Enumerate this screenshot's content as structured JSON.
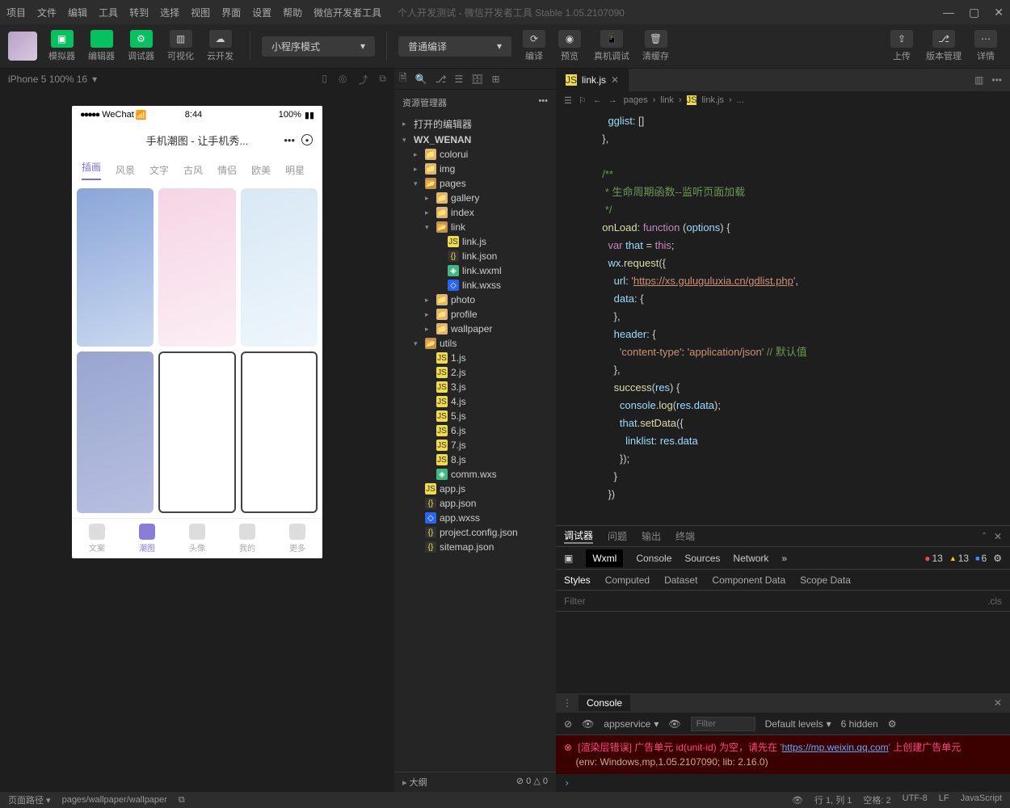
{
  "menubar": [
    "项目",
    "文件",
    "编辑",
    "工具",
    "转到",
    "选择",
    "视图",
    "界面",
    "设置",
    "帮助",
    "微信开发者工具"
  ],
  "window_title": "个人开发测试 - 微信开发者工具 Stable 1.05.2107090",
  "toolbar": {
    "groups_a": [
      {
        "label": "模拟器",
        "green": true
      },
      {
        "label": "编辑器",
        "green": true
      },
      {
        "label": "调试器",
        "green": true
      },
      {
        "label": "可视化",
        "green": false
      },
      {
        "label": "云开发",
        "green": false
      }
    ],
    "mode_dropdown": "小程序模式",
    "compile_dropdown": "普通编译",
    "mid": [
      "编译",
      "预览",
      "真机调试",
      "清缓存"
    ],
    "right": [
      "上传",
      "版本管理",
      "详情"
    ]
  },
  "sim": {
    "device": "iPhone 5 100% 16",
    "status_carrier": "WeChat",
    "status_time": "8:44",
    "status_batt": "100%",
    "app_title": "手机潮图 - 让手机秀...",
    "tabs": [
      "插画",
      "风景",
      "文字",
      "古风",
      "情侣",
      "欧美",
      "明星"
    ],
    "bottom": [
      "文案",
      "潮图",
      "头像",
      "我的",
      "更多"
    ]
  },
  "explorer": {
    "header": "资源管理器",
    "sections": [
      "打开的编辑器",
      "WX_WENAN"
    ],
    "tree": [
      {
        "l": 1,
        "t": "folder",
        "n": "colorui",
        "a": "▸"
      },
      {
        "l": 1,
        "t": "folder",
        "n": "img",
        "a": "▸"
      },
      {
        "l": 1,
        "t": "folder-open",
        "n": "pages",
        "a": "▾"
      },
      {
        "l": 2,
        "t": "folder",
        "n": "gallery",
        "a": "▸"
      },
      {
        "l": 2,
        "t": "folder",
        "n": "index",
        "a": "▸"
      },
      {
        "l": 2,
        "t": "folder-open",
        "n": "link",
        "a": "▾"
      },
      {
        "l": 3,
        "t": "js",
        "n": "link.js"
      },
      {
        "l": 3,
        "t": "json",
        "n": "link.json"
      },
      {
        "l": 3,
        "t": "wxml",
        "n": "link.wxml"
      },
      {
        "l": 3,
        "t": "wxss",
        "n": "link.wxss"
      },
      {
        "l": 2,
        "t": "folder",
        "n": "photo",
        "a": "▸"
      },
      {
        "l": 2,
        "t": "folder",
        "n": "profile",
        "a": "▸"
      },
      {
        "l": 2,
        "t": "folder",
        "n": "wallpaper",
        "a": "▸"
      },
      {
        "l": 1,
        "t": "folder-open",
        "n": "utils",
        "a": "▾"
      },
      {
        "l": 2,
        "t": "js",
        "n": "1.js"
      },
      {
        "l": 2,
        "t": "js",
        "n": "2.js"
      },
      {
        "l": 2,
        "t": "js",
        "n": "3.js"
      },
      {
        "l": 2,
        "t": "js",
        "n": "4.js"
      },
      {
        "l": 2,
        "t": "js",
        "n": "5.js"
      },
      {
        "l": 2,
        "t": "js",
        "n": "6.js"
      },
      {
        "l": 2,
        "t": "js",
        "n": "7.js"
      },
      {
        "l": 2,
        "t": "js",
        "n": "8.js"
      },
      {
        "l": 2,
        "t": "wxml",
        "n": "comm.wxs"
      },
      {
        "l": 1,
        "t": "js",
        "n": "app.js"
      },
      {
        "l": 1,
        "t": "json",
        "n": "app.json"
      },
      {
        "l": 1,
        "t": "wxss",
        "n": "app.wxss"
      },
      {
        "l": 1,
        "t": "json",
        "n": "project.config.json"
      },
      {
        "l": 1,
        "t": "json",
        "n": "sitemap.json"
      }
    ],
    "outline": "大纲",
    "outline_counts": "⊘ 0 △ 0"
  },
  "editor": {
    "tab": "link.js",
    "breadcrumb": [
      "pages",
      "link",
      "link.js",
      "..."
    ],
    "code_comment1": "/**",
    "code_comment2": " * 生命周期函数--监听页面加载",
    "code_comment3": " */",
    "url": "https://xs.guluguluxia.cn/gdlist.php",
    "header_ct": "content-type",
    "header_val": "application/json",
    "header_comm": "// 默认值"
  },
  "devtools": {
    "top_tabs": [
      "调试器",
      "问题",
      "输出",
      "终端"
    ],
    "panels": [
      "Wxml",
      "Console",
      "Sources",
      "Network"
    ],
    "err_count": "13",
    "warn_count": "13",
    "info_count": "6",
    "style_tabs": [
      "Styles",
      "Computed",
      "Dataset",
      "Component Data",
      "Scope Data"
    ],
    "filter_placeholder": "Filter",
    "cls_label": ".cls",
    "console_tab": "Console",
    "console_context": "appservice",
    "console_filter": "Filter",
    "console_levels": "Default levels",
    "console_hidden": "6 hidden",
    "err_text": "[渲染层错误] 广告单元 id(unit-id) 为空，请先在 '",
    "err_link": "https://mp.weixin.qq.com",
    "err_text2": "' 上创建广告单元",
    "err_env": "(env: Windows,mp,1.05.2107090; lib: 2.16.0)"
  },
  "statusbar": {
    "left1": "页面路径",
    "left2": "pages/wallpaper/wallpaper",
    "right": [
      "行 1, 列 1",
      "空格: 2",
      "UTF-8",
      "LF",
      "JavaScript"
    ]
  }
}
